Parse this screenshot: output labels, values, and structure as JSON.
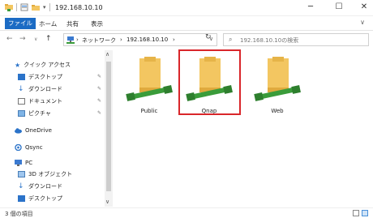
{
  "window": {
    "title": "192.168.10.10"
  },
  "ribbon": {
    "tabs": [
      "ファイル",
      "ホーム",
      "共有",
      "表示"
    ]
  },
  "address": {
    "crumbs": [
      "ネットワーク",
      "192.168.10.10"
    ],
    "search_placeholder": "192.168.10.10の検索"
  },
  "nav": {
    "quick_access": "クイック アクセス",
    "quick_items": [
      "デスクトップ",
      "ダウンロード",
      "ドキュメント",
      "ピクチャ"
    ],
    "onedrive": "OneDrive",
    "qsync": "Qsync",
    "pc": "PC",
    "pc_items": [
      "3D オブジェクト",
      "ダウンロード",
      "デスクトップ"
    ]
  },
  "folders": [
    {
      "name": "Public",
      "selected": false
    },
    {
      "name": "Qnap",
      "selected": true
    },
    {
      "name": "Web",
      "selected": false
    }
  ],
  "status": {
    "item_count": "3 個の項目"
  },
  "colors": {
    "accent": "#1b6bc4",
    "selection": "#d9262a",
    "folder": "#f3c661",
    "network": "#3a9c3a"
  }
}
